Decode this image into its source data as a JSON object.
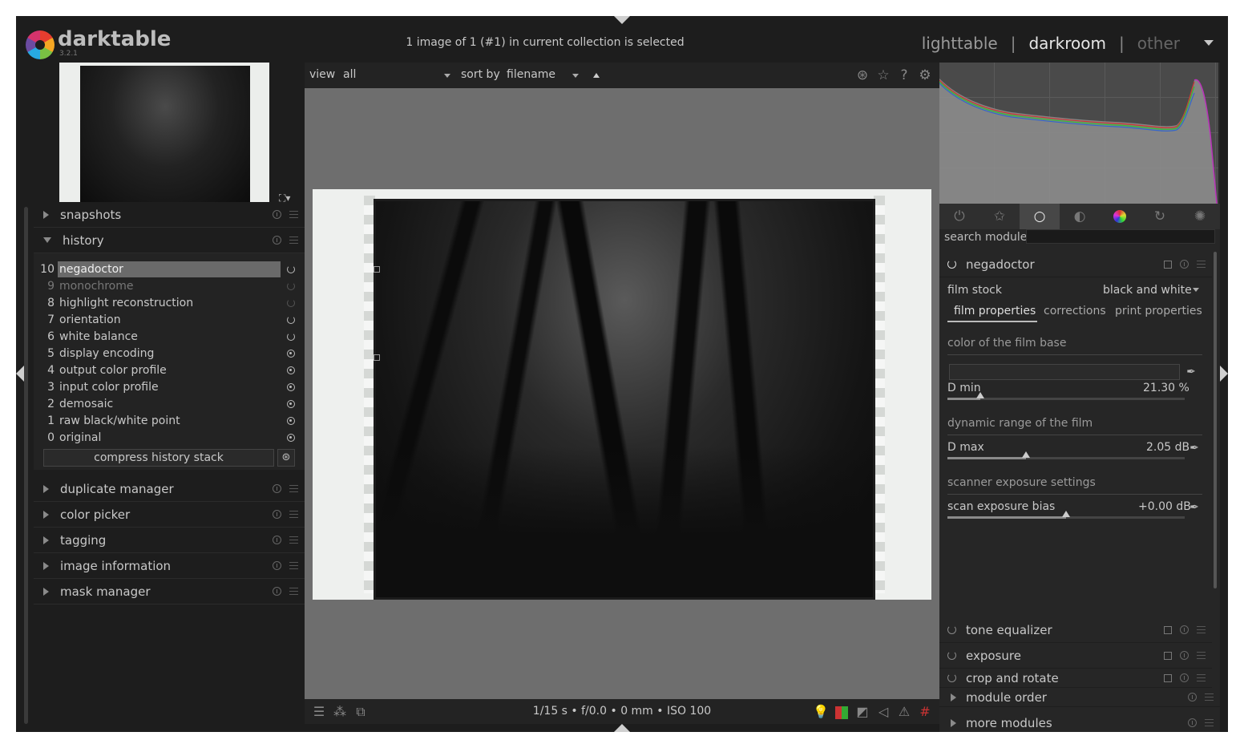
{
  "app": {
    "name": "darktable",
    "version": "3.2.1"
  },
  "header": {
    "status": "1 image of 1 (#1) in current collection is selected",
    "views": {
      "lighttable": "lighttable",
      "darkroom": "darkroom",
      "other": "other",
      "sep": "|"
    }
  },
  "left": {
    "snapshots": "snapshots",
    "history": {
      "title": "history",
      "items": [
        {
          "num": "10",
          "name": "negadoctor"
        },
        {
          "num": "9",
          "name": "monochrome"
        },
        {
          "num": "8",
          "name": "highlight reconstruction"
        },
        {
          "num": "7",
          "name": "orientation"
        },
        {
          "num": "6",
          "name": "white balance"
        },
        {
          "num": "5",
          "name": "display encoding"
        },
        {
          "num": "4",
          "name": "output color profile"
        },
        {
          "num": "3",
          "name": "input color profile"
        },
        {
          "num": "2",
          "name": "demosaic"
        },
        {
          "num": "1",
          "name": "raw black/white point"
        },
        {
          "num": "0",
          "name": "original"
        }
      ],
      "compress": "compress history stack"
    },
    "modules": [
      "duplicate manager",
      "color picker",
      "tagging",
      "image information",
      "mask manager"
    ]
  },
  "center": {
    "view_label": "view",
    "view_value": "all",
    "sort_label": "sort by",
    "sort_value": "filename",
    "exif": "1/15 s • f/0.0 • 0 mm • ISO 100"
  },
  "right": {
    "search_label": "search module",
    "negadoctor": {
      "title": "negadoctor",
      "film_stock_label": "film stock",
      "film_stock_value": "black and white",
      "tabs": [
        "film properties",
        "corrections",
        "print properties"
      ],
      "sec_base": "color of the film base",
      "dmin_label": "D min",
      "dmin_value": "21.30 %",
      "dmin_pos": 0.14,
      "sec_range": "dynamic range of the film",
      "dmax_label": "D max",
      "dmax_value": "2.05 dB",
      "dmax_pos": 0.33,
      "sec_scanner": "scanner exposure settings",
      "bias_label": "scan exposure bias",
      "bias_value": "+0.00 dB",
      "bias_pos": 0.5
    },
    "modules": [
      "tone equalizer",
      "exposure",
      "crop and rotate"
    ],
    "module_order": "module order",
    "more_modules": "more modules"
  },
  "colors": {
    "accent": "#c8c8c8",
    "panel": "#262626",
    "canvas": "#6e6e6e"
  }
}
